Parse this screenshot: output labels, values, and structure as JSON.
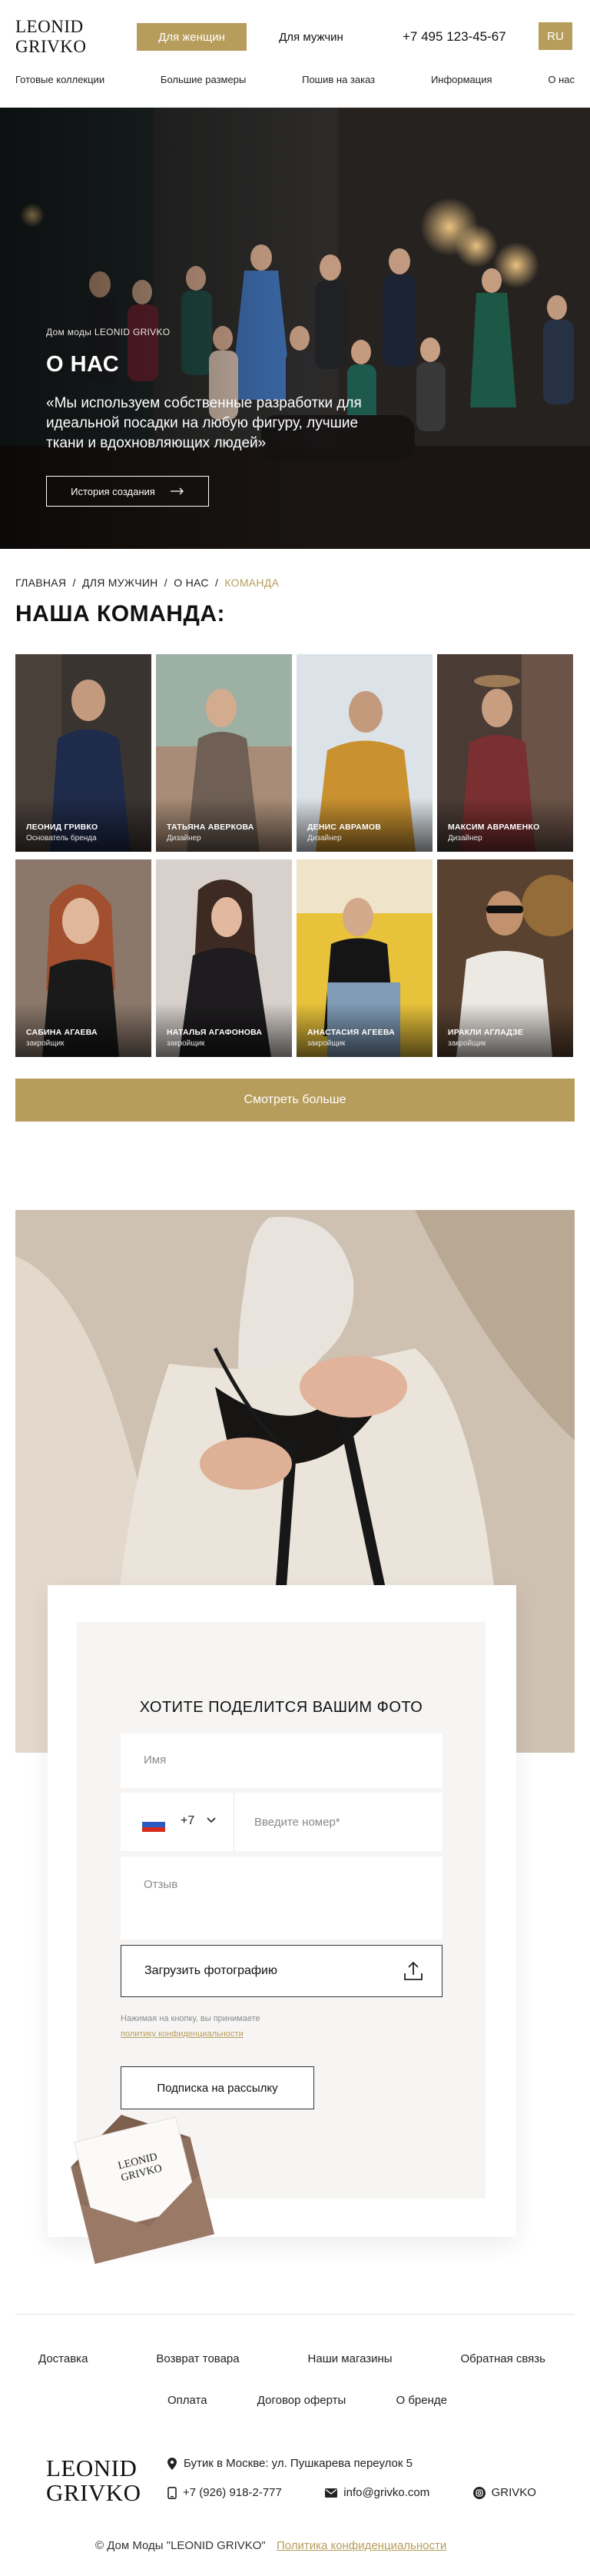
{
  "header": {
    "logo": [
      "LEONID",
      "GRIVKO"
    ],
    "women_button": "Для женщин",
    "men_button": "Для мужчин",
    "phone": "+7 495 123-45-67",
    "lang": "RU",
    "nav": [
      "Готовые коллекции",
      "Большие размеры",
      "Пошив на заказ",
      "Информация",
      "О нас"
    ]
  },
  "hero": {
    "subtitle": "Дом моды LEONID GRIVKO",
    "title": "О НАС",
    "quote": "«Мы используем собственные разработки для идеальной посадки на любую фигуру, лучшие ткани и вдохновляющих людей»",
    "button": "История создания"
  },
  "breadcrumb": {
    "items": [
      "ГЛАВНАЯ",
      "ДЛЯ МУЖЧИН",
      "О НАС"
    ],
    "separator": "/",
    "current": "КОМАНДА"
  },
  "team": {
    "title": "НАША КОМАНДА:",
    "members": [
      {
        "name": "ЛЕОНИД ГРИВКО",
        "role": "Основатель бренда"
      },
      {
        "name": "ТАТЬЯНА АВЕРКОВА",
        "role": "Дизайнер"
      },
      {
        "name": "ДЕНИС АВРАМОВ",
        "role": "Дизайнер"
      },
      {
        "name": "МАКСИМ АВРАМЕНКО",
        "role": "Дизайнер"
      },
      {
        "name": "САБИНА АГАЕВА",
        "role": "закройщик"
      },
      {
        "name": "НАТАЛЬЯ АГАФОНОВА",
        "role": "закройщик"
      },
      {
        "name": "АНАСТАСИЯ АГЕЕВА",
        "role": "закройщик"
      },
      {
        "name": "ИРАКЛИ АГЛАДЗЕ",
        "role": "закройщик"
      }
    ],
    "more_button": "Смотреть больше"
  },
  "form": {
    "title": "ХОТИТЕ ПОДЕЛИТСЯ ВАШИМ ФОТО",
    "name_placeholder": "Имя",
    "phone_code": "+7",
    "phone_placeholder": "Введите номер*",
    "review_placeholder": "Отзыв",
    "upload_label": "Загрузить фотографию",
    "consent_text": "Нажимая на кнопку, вы принимаете",
    "consent_link": "политику конфиденциальности",
    "subscribe_button": "Подписка на рассылку",
    "envelope_logo": [
      "LEONID",
      "GRIVKO"
    ]
  },
  "footer": {
    "nav_row1": [
      "Доставка",
      "Возврат товара",
      "Наши магазины",
      "Обратная связь"
    ],
    "nav_row2": [
      "Оплата",
      "Договор оферты",
      "О бренде"
    ],
    "logo": [
      "LEONID",
      "GRIVKO"
    ],
    "address": "Бутик в Москве: ул. Пушкарева переулок 5",
    "phone": "+7 (926) 918-2-777",
    "email": "info@grivko.com",
    "social": "GRIVKO",
    "copyright": "© Дом Моды \"LEONID GRIVKO\"",
    "policy": "Политика конфиденциальности"
  },
  "colors": {
    "accent": "#b79d5b",
    "text": "#1a1a1a",
    "muted": "#8a8a8a",
    "form_bg": "#f6f5f4"
  }
}
